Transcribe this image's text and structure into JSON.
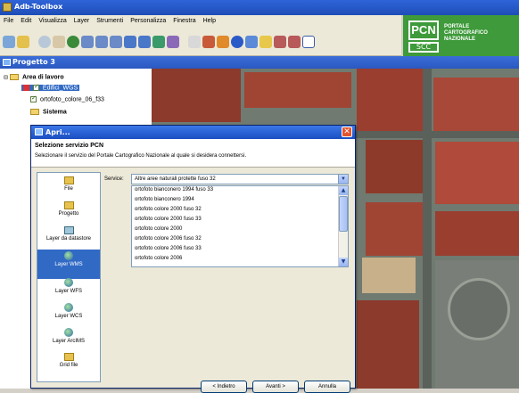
{
  "app": {
    "title": "Adb-Toolbox"
  },
  "menu": [
    "File",
    "Edit",
    "Visualizza",
    "Layer",
    "Strumenti",
    "Personalizza",
    "Finestra",
    "Help"
  ],
  "logo": {
    "line1": "PCN",
    "line2": "SCC",
    "text1": "PORTALE",
    "text2": "CARTOGRAFICO",
    "text3": "NAZIONALE"
  },
  "project": {
    "title": "Progetto 3"
  },
  "tree": {
    "area": "Area di lavoro",
    "layer1": "Edifici_WGS",
    "layer2": "ortofoto_colore_06_f33",
    "sistema": "Sistema"
  },
  "dialog": {
    "title": "Apri...",
    "heading": "Selezione servizio PCN",
    "subheading": "Selezionare il servizio del Portale Cartografico Nazionale al quale si desidera connettersi.",
    "service_label": "Service:",
    "service_value": "Altre aree naturali protette fuso 32",
    "service_options": [
      "ortofoto bianconero 1994 fuso 33",
      "ortofoto bianconero 1994",
      "ortofoto colore 2000 fuso 32",
      "ortofoto colore 2000 fuso 33",
      "ortofoto colore 2000",
      "ortofoto colore 2006 fuso 32",
      "ortofoto colore 2006 fuso 33",
      "ortofoto colore 2006"
    ],
    "sources": [
      "File",
      "Progetto",
      "Layer da datastore",
      "Layer WMS",
      "Layer WFS",
      "Layer WCS",
      "Layer ArcIMS",
      "Grid file"
    ],
    "selected_source": "Layer WMS",
    "buttons": {
      "back": "< Indietro",
      "next": "Avanti >",
      "cancel": "Annulla"
    }
  }
}
